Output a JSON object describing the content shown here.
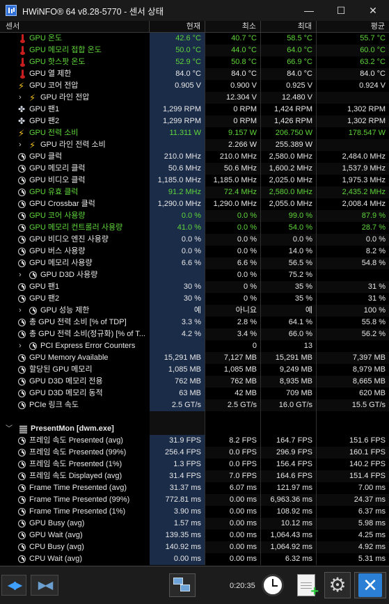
{
  "window": {
    "title": "HWiNFO® 64 v8.28-5770 - 센서 상태",
    "minimize": "—",
    "maximize": "☐",
    "close": "✕"
  },
  "columns": [
    "센서",
    "현재",
    "최소",
    "최대",
    "평균"
  ],
  "rows": [
    {
      "icon": "temp",
      "indent": 0,
      "label": "GPU 온도",
      "cur": "42.6 °C",
      "min": "40.7 °C",
      "max": "58.5 °C",
      "avg": "55.7 °C",
      "green": true
    },
    {
      "icon": "temp",
      "indent": 0,
      "label": "GPU 메모리 접합 온도",
      "cur": "50.0 °C",
      "min": "44.0 °C",
      "max": "64.0 °C",
      "avg": "60.0 °C",
      "green": true
    },
    {
      "icon": "temp",
      "indent": 0,
      "label": "GPU 핫스팟 온도",
      "cur": "52.9 °C",
      "min": "50.8 °C",
      "max": "66.9 °C",
      "avg": "63.2 °C",
      "green": true
    },
    {
      "icon": "temp",
      "indent": 0,
      "label": "GPU 열 제한",
      "cur": "84.0 °C",
      "min": "84.0 °C",
      "max": "84.0 °C",
      "avg": "84.0 °C",
      "green": false
    },
    {
      "icon": "volt",
      "indent": 0,
      "label": "GPU 코어 전압",
      "cur": "0.905 V",
      "min": "0.900 V",
      "max": "0.925 V",
      "avg": "0.924 V",
      "green": false
    },
    {
      "icon": "volt",
      "indent": 1,
      "label": "GPU 라인 전압",
      "cur": "",
      "min": "12.304 V",
      "max": "12.480 V",
      "avg": "",
      "green": false
    },
    {
      "icon": "fan",
      "indent": 0,
      "label": "GPU 팬1",
      "cur": "1,299 RPM",
      "min": "0 RPM",
      "max": "1,424 RPM",
      "avg": "1,302 RPM",
      "green": false
    },
    {
      "icon": "fan",
      "indent": 0,
      "label": "GPU 팬2",
      "cur": "1,299 RPM",
      "min": "0 RPM",
      "max": "1,426 RPM",
      "avg": "1,302 RPM",
      "green": false
    },
    {
      "icon": "volt",
      "indent": 0,
      "label": "GPU 전력 소비",
      "cur": "11.311 W",
      "min": "9.157 W",
      "max": "206.750 W",
      "avg": "178.547 W",
      "green": true
    },
    {
      "icon": "volt",
      "indent": 1,
      "label": "GPU 라인 전력 소비",
      "cur": "",
      "min": "2.266 W",
      "max": "255.389 W",
      "avg": "",
      "green": false
    },
    {
      "icon": "clock",
      "indent": 0,
      "label": "GPU 클럭",
      "cur": "210.0 MHz",
      "min": "210.0 MHz",
      "max": "2,580.0 MHz",
      "avg": "2,484.0 MHz",
      "green": false
    },
    {
      "icon": "clock",
      "indent": 0,
      "label": "GPU 메모리 클럭",
      "cur": "50.6 MHz",
      "min": "50.6 MHz",
      "max": "1,600.2 MHz",
      "avg": "1,537.9 MHz",
      "green": false
    },
    {
      "icon": "clock",
      "indent": 0,
      "label": "GPU 비디오 클럭",
      "cur": "1,185.0 MHz",
      "min": "1,185.0 MHz",
      "max": "2,025.0 MHz",
      "avg": "1,975.3 MHz",
      "green": false
    },
    {
      "icon": "clock",
      "indent": 0,
      "label": "GPU 유효 클럭",
      "cur": "91.2 MHz",
      "min": "72.4 MHz",
      "max": "2,580.0 MHz",
      "avg": "2,435.2 MHz",
      "green": true
    },
    {
      "icon": "clock",
      "indent": 0,
      "label": "GPU Crossbar 클럭",
      "cur": "1,290.0 MHz",
      "min": "1,290.0 MHz",
      "max": "2,055.0 MHz",
      "avg": "2,008.4 MHz",
      "green": false
    },
    {
      "icon": "clock",
      "indent": 0,
      "label": "GPU 코어 사용량",
      "cur": "0.0 %",
      "min": "0.0 %",
      "max": "99.0 %",
      "avg": "87.9 %",
      "green": true
    },
    {
      "icon": "clock",
      "indent": 0,
      "label": "GPU 메모리 컨트롤러 사용량",
      "cur": "41.0 %",
      "min": "0.0 %",
      "max": "54.0 %",
      "avg": "28.7 %",
      "green": true
    },
    {
      "icon": "clock",
      "indent": 0,
      "label": "GPU 비디오 엔진 사용량",
      "cur": "0.0 %",
      "min": "0.0 %",
      "max": "0.0 %",
      "avg": "0.0 %",
      "green": false
    },
    {
      "icon": "clock",
      "indent": 0,
      "label": "GPU 버스 사용량",
      "cur": "0.0 %",
      "min": "0.0 %",
      "max": "14.0 %",
      "avg": "8.2 %",
      "green": false
    },
    {
      "icon": "clock",
      "indent": 0,
      "label": "GPU 메모리 사용량",
      "cur": "6.6 %",
      "min": "6.6 %",
      "max": "56.5 %",
      "avg": "54.8 %",
      "green": false
    },
    {
      "icon": "clock",
      "indent": 1,
      "label": "GPU D3D 사용량",
      "cur": "",
      "min": "0.0 %",
      "max": "75.2 %",
      "avg": "",
      "green": false
    },
    {
      "icon": "clock",
      "indent": 0,
      "label": "GPU 팬1",
      "cur": "30 %",
      "min": "0 %",
      "max": "35 %",
      "avg": "31 %",
      "green": false
    },
    {
      "icon": "clock",
      "indent": 0,
      "label": "GPU 팬2",
      "cur": "30 %",
      "min": "0 %",
      "max": "35 %",
      "avg": "31 %",
      "green": false
    },
    {
      "icon": "clock",
      "indent": 1,
      "label": "GPU 성능 제한",
      "cur": "예",
      "min": "아니요",
      "max": "예",
      "avg": "100 %",
      "green": false
    },
    {
      "icon": "clock",
      "indent": 0,
      "label": "총 GPU 전력 소비 [% of TDP]",
      "cur": "3.3 %",
      "min": "2.8 %",
      "max": "64.1 %",
      "avg": "55.8 %",
      "green": false
    },
    {
      "icon": "clock",
      "indent": 0,
      "label": "총 GPU 전력 소비(정규화) [% of T...",
      "cur": "4.2 %",
      "min": "3.4 %",
      "max": "66.0 %",
      "avg": "56.2 %",
      "green": false
    },
    {
      "icon": "clock",
      "indent": 1,
      "label": "PCI Express Error Counters",
      "cur": "",
      "min": "0",
      "max": "13",
      "avg": "",
      "green": false
    },
    {
      "icon": "clock",
      "indent": 0,
      "label": "GPU Memory Available",
      "cur": "15,291 MB",
      "min": "7,127 MB",
      "max": "15,291 MB",
      "avg": "7,397 MB",
      "green": false
    },
    {
      "icon": "clock",
      "indent": 0,
      "label": "할당된 GPU 메모리",
      "cur": "1,085 MB",
      "min": "1,085 MB",
      "max": "9,249 MB",
      "avg": "8,979 MB",
      "green": false
    },
    {
      "icon": "clock",
      "indent": 0,
      "label": "GPU D3D 메모리 전용",
      "cur": "762 MB",
      "min": "762 MB",
      "max": "8,935 MB",
      "avg": "8,665 MB",
      "green": false
    },
    {
      "icon": "clock",
      "indent": 0,
      "label": "GPU D3D 메모리 동적",
      "cur": "63 MB",
      "min": "42 MB",
      "max": "709 MB",
      "avg": "620 MB",
      "green": false
    },
    {
      "icon": "clock",
      "indent": 0,
      "label": "PCIe 링크 속도",
      "cur": "2.5 GT/s",
      "min": "2.5 GT/s",
      "max": "16.0 GT/s",
      "avg": "15.5 GT/s",
      "green": false
    },
    {
      "icon": "blank",
      "indent": 0,
      "label": "",
      "cur": "",
      "min": "",
      "max": "",
      "avg": "",
      "green": false
    },
    {
      "icon": "group",
      "indent": 0,
      "label": "PresentMon [dwm.exe]",
      "cur": "",
      "min": "",
      "max": "",
      "avg": "",
      "green": false
    },
    {
      "icon": "clock",
      "indent": 0,
      "label": "프레임 속도 Presented (avg)",
      "cur": "31.9 FPS",
      "min": "8.2 FPS",
      "max": "164.7 FPS",
      "avg": "151.6 FPS",
      "green": false
    },
    {
      "icon": "clock",
      "indent": 0,
      "label": "프레임 속도 Presented (99%)",
      "cur": "256.4 FPS",
      "min": "0.0 FPS",
      "max": "296.9 FPS",
      "avg": "160.1 FPS",
      "green": false
    },
    {
      "icon": "clock",
      "indent": 0,
      "label": "프레임 속도 Presented (1%)",
      "cur": "1.3 FPS",
      "min": "0.0 FPS",
      "max": "156.4 FPS",
      "avg": "140.2 FPS",
      "green": false
    },
    {
      "icon": "clock",
      "indent": 0,
      "label": "프레임 속도 Displayed (avg)",
      "cur": "31.4 FPS",
      "min": "7.0 FPS",
      "max": "164.6 FPS",
      "avg": "151.4 FPS",
      "green": false
    },
    {
      "icon": "clock",
      "indent": 0,
      "label": "Frame Time Presented (avg)",
      "cur": "31.37 ms",
      "min": "6.07 ms",
      "max": "121.97 ms",
      "avg": "7.00 ms",
      "green": false
    },
    {
      "icon": "clock",
      "indent": 0,
      "label": "Frame Time Presented (99%)",
      "cur": "772.81 ms",
      "min": "0.00 ms",
      "max": "6,963.36 ms",
      "avg": "24.37 ms",
      "green": false
    },
    {
      "icon": "clock",
      "indent": 0,
      "label": "Frame Time Presented (1%)",
      "cur": "3.90 ms",
      "min": "0.00 ms",
      "max": "108.92 ms",
      "avg": "6.37 ms",
      "green": false
    },
    {
      "icon": "clock",
      "indent": 0,
      "label": "GPU Busy (avg)",
      "cur": "1.57 ms",
      "min": "0.00 ms",
      "max": "10.12 ms",
      "avg": "5.98 ms",
      "green": false
    },
    {
      "icon": "clock",
      "indent": 0,
      "label": "GPU Wait (avg)",
      "cur": "139.35 ms",
      "min": "0.00 ms",
      "max": "1,064.43 ms",
      "avg": "4.25 ms",
      "green": false
    },
    {
      "icon": "clock",
      "indent": 0,
      "label": "CPU Busy (avg)",
      "cur": "140.92 ms",
      "min": "0.00 ms",
      "max": "1,064.92 ms",
      "avg": "4.92 ms",
      "green": false
    },
    {
      "icon": "clock",
      "indent": 0,
      "label": "CPU Wait (avg)",
      "cur": "0.00 ms",
      "min": "0.00 ms",
      "max": "6.32 ms",
      "avg": "5.31 ms",
      "green": false
    }
  ],
  "footer": {
    "timer": "0:20:35"
  },
  "colors": {
    "green_text": "#5fd63a",
    "current_col_bg": "#1b2c49",
    "accent_blue": "#2b7fd4"
  }
}
